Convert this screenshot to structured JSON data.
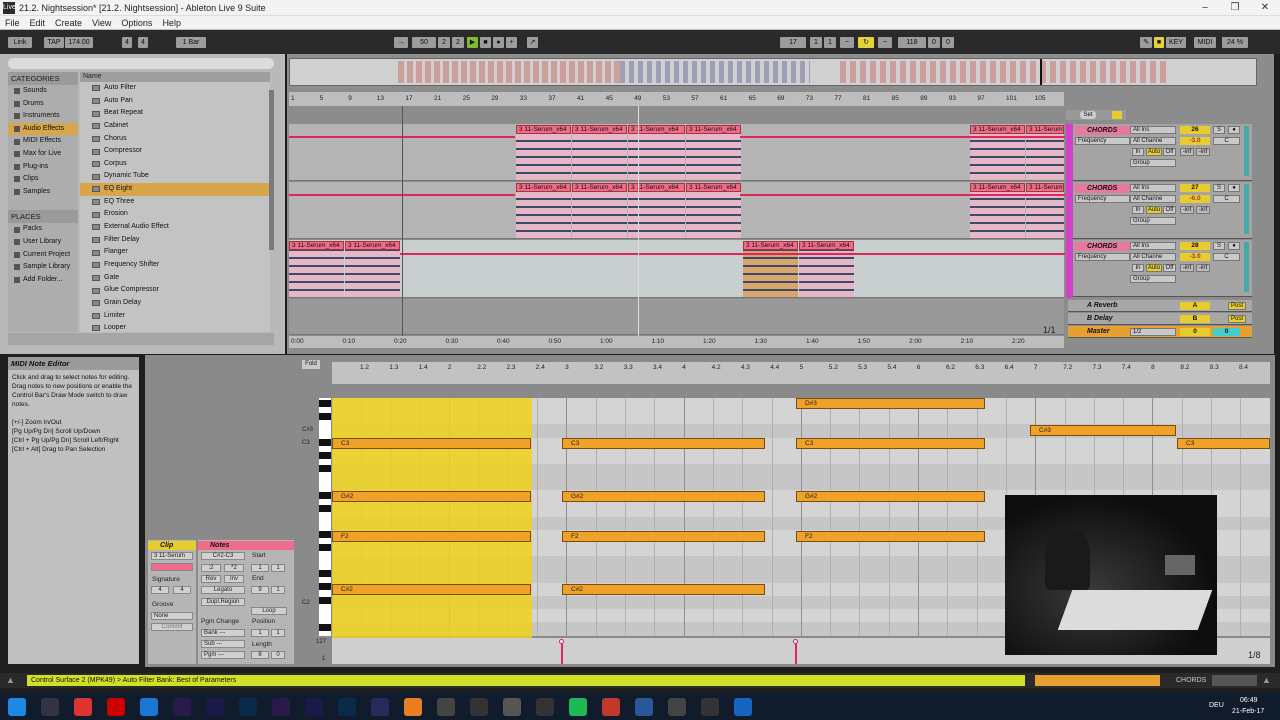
{
  "window": {
    "title": "21.2. Nightsession*  [21.2. Nightsession]  - Ableton Live 9 Suite",
    "app_badge": "Live"
  },
  "menu": [
    "File",
    "Edit",
    "Create",
    "View",
    "Options",
    "Help"
  ],
  "control_bar": {
    "link": "Link",
    "tap": "TAP",
    "tempo": "174.00",
    "sig_num": "4",
    "sig_den": "4",
    "quantize": "1 Bar",
    "position": [
      "50",
      "2",
      "2"
    ],
    "loop_start": [
      "17",
      "1",
      "1"
    ],
    "loop_length": [
      "118",
      "0",
      "0"
    ],
    "key": "KEY",
    "midi": "MIDI",
    "cpu": "24 %"
  },
  "browser": {
    "categories_header": "CATEGORIES",
    "categories": [
      "Sounds",
      "Drums",
      "Instruments",
      "Audio Effects",
      "MIDI Effects",
      "Max for Live",
      "Plug-ins",
      "Clips",
      "Samples"
    ],
    "selected_category": "Audio Effects",
    "places_header": "PLACES",
    "places": [
      "Packs",
      "User Library",
      "Current Project",
      "Sample Library",
      "Add Folder..."
    ],
    "name_header": "Name",
    "items": [
      "Auto Filter",
      "Auto Pan",
      "Beat Repeat",
      "Cabinet",
      "Chorus",
      "Compressor",
      "Corpus",
      "Dynamic Tube",
      "EQ Eight",
      "EQ Three",
      "Erosion",
      "External Audio Effect",
      "Filter Delay",
      "Flanger",
      "Frequency Shifter",
      "Gate",
      "Glue Compressor",
      "Grain Delay",
      "Limiter",
      "Looper"
    ],
    "selected_item": "EQ Eight"
  },
  "arrangement": {
    "bar_ruler": [
      "1",
      "5",
      "9",
      "13",
      "17",
      "21",
      "25",
      "29",
      "33",
      "37",
      "41",
      "45",
      "49",
      "53",
      "57",
      "61",
      "65",
      "69",
      "73",
      "77",
      "81",
      "85",
      "89",
      "93",
      "97",
      "101",
      "105"
    ],
    "time_ruler": [
      "0:00",
      "0:10",
      "0:20",
      "0:30",
      "0:40",
      "0:50",
      "1:00",
      "1:10",
      "1:20",
      "1:30",
      "1:40",
      "1:50",
      "2:00",
      "2:10",
      "2:20"
    ],
    "clip_name": "3 11-Serum_x64",
    "clip_name_short": "3 11-Serum",
    "page": "1/1"
  },
  "mixer": {
    "tracks": [
      {
        "name": "CHORDS",
        "automation": "Frequency",
        "input": "All Ins",
        "channel": "All Channe",
        "number": "26",
        "volume": "-3.0",
        "pan": "C",
        "group": "Group",
        "sends": [
          "-inf",
          "-inf"
        ]
      },
      {
        "name": "CHORDS",
        "automation": "Frequency",
        "input": "All Ins",
        "channel": "All Channe",
        "number": "27",
        "volume": "-6.0",
        "pan": "C",
        "group": "Group",
        "sends": [
          "-inf",
          "-inf"
        ]
      },
      {
        "name": "CHORDS",
        "automation": "Frequency",
        "input": "All Ins",
        "channel": "All Channe",
        "number": "28",
        "volume": "-3.0",
        "pan": "C",
        "group": "Group",
        "sends": [
          "-inf",
          "-inf"
        ]
      }
    ],
    "monitor": {
      "in": "In",
      "auto": "Auto",
      "off": "Off"
    },
    "solo": "S",
    "returns": [
      {
        "name": "A Reverb",
        "letter": "A",
        "post": "Post"
      },
      {
        "name": "B Delay",
        "letter": "B",
        "post": "Post"
      }
    ],
    "master": {
      "name": "Master",
      "cue": "1/2",
      "value": "0",
      "value2": "0"
    },
    "set_label": "Set"
  },
  "info": {
    "title": "MIDI Note Editor",
    "text": "Click and drag to select notes for editing. Drag notes to new positions or enable the Control Bar's Draw Mode switch to draw notes.\n\n[+/-] Zoom In/Out\n[Pg Up/Pg Dn] Scroll Up/Down\n[Ctrl + Pg Up/Pg Dn] Scroll Left/Right\n[Ctrl + Alt] Drag to Pan Selection"
  },
  "clip_panel": {
    "header": "Clip",
    "name": "3 11-Serum",
    "signature_label": "Signature",
    "sig_num": "4",
    "sig_den": "4",
    "groove_label": "Groove",
    "groove_value": "None",
    "commit": "Commit"
  },
  "notes_panel": {
    "header": "Notes",
    "range": "C#2-C3",
    "half": ":2",
    "double": "*2",
    "rev": "Rev",
    "inv": "Inv",
    "legato": "Legato",
    "dupl": "Dupl.Region",
    "start_label": "Start",
    "start": [
      "1",
      "1"
    ],
    "end_label": "End",
    "end": [
      "9",
      "1"
    ],
    "loop": "Loop",
    "pgm_change": "Pgm Change",
    "position_label": "Position",
    "position": [
      "1",
      "1"
    ],
    "bank": "Bank ---",
    "sub": "Sub ---",
    "pgm": "Pgm ---",
    "length_label": "Length",
    "length": [
      "8",
      "0"
    ]
  },
  "note_editor": {
    "fold": "Fold",
    "ruler": [
      "1.2",
      "1.3",
      "1.4",
      "2",
      "2.2",
      "2.3",
      "2.4",
      "3",
      "3.2",
      "3.3",
      "3.4",
      "4",
      "4.2",
      "4.3",
      "4.4",
      "5",
      "5.2",
      "5.3",
      "5.4",
      "6",
      "6.2",
      "6.3",
      "6.4",
      "7",
      "7.2",
      "7.3",
      "7.4",
      "8",
      "8.2",
      "8.3",
      "8.4"
    ],
    "key_labels": [
      "C#3",
      "C3",
      "C2"
    ],
    "notes": [
      {
        "pitch": "C3",
        "label": "C3",
        "col": 0
      },
      {
        "pitch": "C3",
        "label": "C3",
        "col": 1
      },
      {
        "pitch": "C3",
        "label": "C3",
        "col": 2
      },
      {
        "pitch": "C3",
        "label": "C3",
        "col": 3
      },
      {
        "pitch": "D#3",
        "label": "D#3",
        "col": 2
      },
      {
        "pitch": "C#3",
        "label": "C#3",
        "col": 4
      },
      {
        "pitch": "G#2",
        "label": "G#2",
        "col": 0
      },
      {
        "pitch": "G#2",
        "label": "G#2",
        "col": 1
      },
      {
        "pitch": "G#2",
        "label": "G#2",
        "col": 2
      },
      {
        "pitch": "F2",
        "label": "F2",
        "col": 0
      },
      {
        "pitch": "F2",
        "label": "F2",
        "col": 1
      },
      {
        "pitch": "F2",
        "label": "F2",
        "col": 2
      },
      {
        "pitch": "C#2",
        "label": "C#2",
        "col": 0
      },
      {
        "pitch": "C#2",
        "label": "C#2",
        "col": 1
      }
    ],
    "velocity_max": "127",
    "velocity_min": "1",
    "page": "1/8"
  },
  "status": {
    "message": "Control Surface 2 (MPK49) > Auto Filter Bank: Best of Parameters",
    "track_label": "CHORDS"
  },
  "taskbar": {
    "time": "06:49",
    "date": "21-Feb-17",
    "lang": "DEU"
  }
}
